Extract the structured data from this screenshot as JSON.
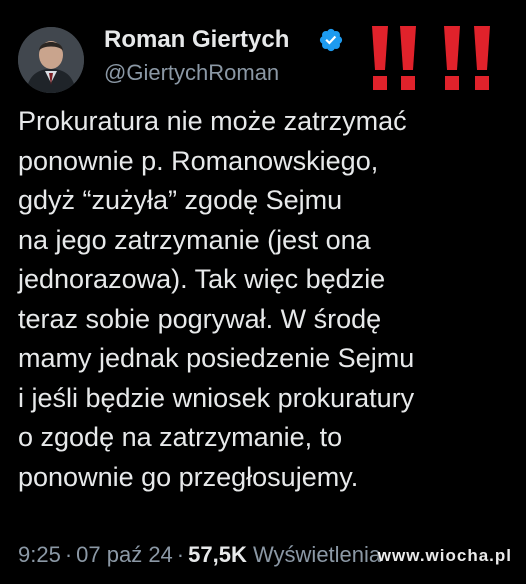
{
  "author": {
    "name": "Roman Giertych",
    "handle": "@GiertychRoman",
    "verified": true
  },
  "decoration": "‼ ‼",
  "tweet": {
    "text": "Prokuratura nie może zatrzymać\nponownie p. Romanowskiego,\ngdyż “zużyła” zgodę Sejmu\nna jego zatrzymanie (jest ona\njednorazowa). Tak więc będzie\nteraz sobie pogrywał. W środę\nmamy jednak posiedzenie Sejmu\ni jeśli będzie wniosek prokuratury\no zgodę na zatrzymanie, to\nponownie go przegłosujemy."
  },
  "meta": {
    "time": "9:25",
    "separator": "·",
    "date": "07 paź 24",
    "views": "57,5K",
    "views_label": "Wyświetlenia"
  },
  "watermark": "www.wiocha.pl",
  "colors": {
    "background": "#000000",
    "text": "#e7e9ea",
    "muted": "#8b98a5",
    "verified": "#1d9bf0",
    "marks": "#e0222b"
  }
}
